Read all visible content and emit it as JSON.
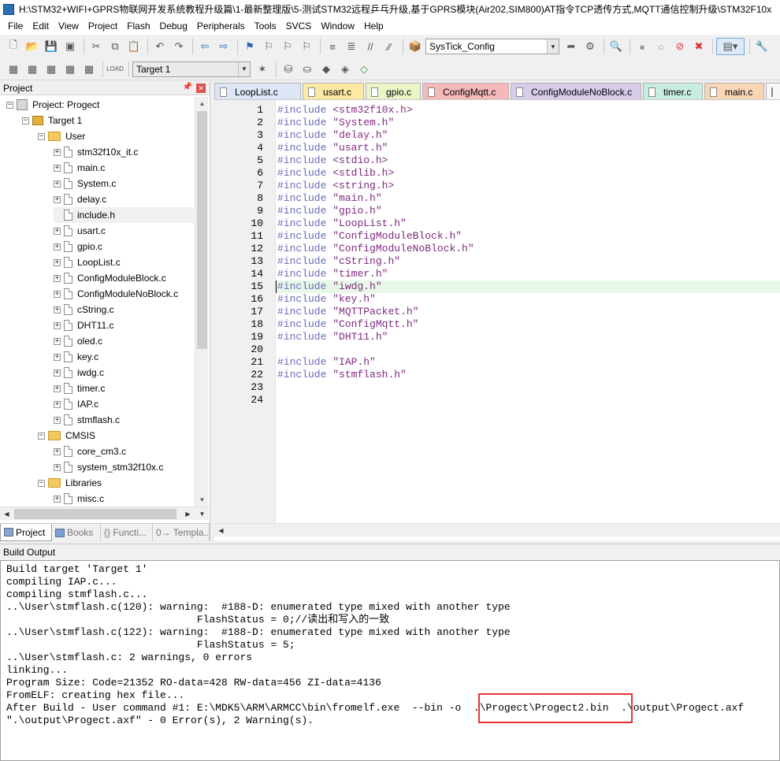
{
  "window": {
    "title": "H:\\STM32+WIFI+GPRS物联网开发系统教程升级篇\\1-最新整理版\\5-测试STM32远程乒乓升级,基于GPRS模块(Air202,SIM800)AT指令TCP透传方式,MQTT通信控制升级\\STM32F10x"
  },
  "menu": [
    "File",
    "Edit",
    "View",
    "Project",
    "Flash",
    "Debug",
    "Peripherals",
    "Tools",
    "SVCS",
    "Window",
    "Help"
  ],
  "toolbar": {
    "function_combo": "SysTick_Config",
    "target_combo": "Target 1"
  },
  "project_panel": {
    "title": "Project",
    "pin": "ᵖ",
    "tree": [
      {
        "label": "Project: Progect",
        "type": "project"
      },
      {
        "label": "Target 1",
        "type": "target"
      },
      {
        "label": "User",
        "type": "folder"
      },
      {
        "label": "stm32f10x_it.c",
        "type": "file"
      },
      {
        "label": "main.c",
        "type": "file"
      },
      {
        "label": "System.c",
        "type": "file"
      },
      {
        "label": "delay.c",
        "type": "file"
      },
      {
        "label": "include.h",
        "type": "file"
      },
      {
        "label": "usart.c",
        "type": "file"
      },
      {
        "label": "gpio.c",
        "type": "file"
      },
      {
        "label": "LoopList.c",
        "type": "file"
      },
      {
        "label": "ConfigModuleBlock.c",
        "type": "file"
      },
      {
        "label": "ConfigModuleNoBlock.c",
        "type": "file"
      },
      {
        "label": "cString.c",
        "type": "file"
      },
      {
        "label": "DHT11.c",
        "type": "file"
      },
      {
        "label": "oled.c",
        "type": "file"
      },
      {
        "label": "key.c",
        "type": "file"
      },
      {
        "label": "iwdg.c",
        "type": "file"
      },
      {
        "label": "timer.c",
        "type": "file"
      },
      {
        "label": "IAP.c",
        "type": "file"
      },
      {
        "label": "stmflash.c",
        "type": "file"
      },
      {
        "label": "CMSIS",
        "type": "folder"
      },
      {
        "label": "core_cm3.c",
        "type": "file"
      },
      {
        "label": "system_stm32f10x.c",
        "type": "file"
      },
      {
        "label": "Libraries",
        "type": "folder"
      },
      {
        "label": "misc.c",
        "type": "file"
      }
    ],
    "tabs": [
      "Project",
      "Books",
      "{} Functi...",
      "0→ Templa..."
    ]
  },
  "editor": {
    "tabs": [
      {
        "label": "LoopList.c",
        "color": "#dde6f5"
      },
      {
        "label": "usart.c",
        "color": "#fbe9a4"
      },
      {
        "label": "gpio.c",
        "color": "#e9f5c7"
      },
      {
        "label": "ConfigMqtt.c",
        "color": "#f5b9b9"
      },
      {
        "label": "ConfigModuleNoBlock.c",
        "color": "#d7cdea"
      },
      {
        "label": "timer.c",
        "color": "#c9ece2"
      },
      {
        "label": "main.c",
        "color": "#f9d6b5"
      }
    ],
    "highlight_line": 15,
    "lines": [
      {
        "n": "1",
        "kw": "#include",
        "arg": "<stm32f10x.h>"
      },
      {
        "n": "2",
        "kw": "#include",
        "arg": "\"System.h\""
      },
      {
        "n": "3",
        "kw": "#include",
        "arg": "\"delay.h\""
      },
      {
        "n": "4",
        "kw": "#include",
        "arg": "\"usart.h\""
      },
      {
        "n": "5",
        "kw": "#include",
        "arg": "<stdio.h>"
      },
      {
        "n": "6",
        "kw": "#include",
        "arg": "<stdlib.h>"
      },
      {
        "n": "7",
        "kw": "#include",
        "arg": "<string.h>"
      },
      {
        "n": "8",
        "kw": "#include",
        "arg": "\"main.h\""
      },
      {
        "n": "9",
        "kw": "#include",
        "arg": "\"gpio.h\""
      },
      {
        "n": "10",
        "kw": "#include",
        "arg": "\"LoopList.h\""
      },
      {
        "n": "11",
        "kw": "#include",
        "arg": "\"ConfigModuleBlock.h\""
      },
      {
        "n": "12",
        "kw": "#include",
        "arg": "\"ConfigModuleNoBlock.h\""
      },
      {
        "n": "13",
        "kw": "#include",
        "arg": "\"cString.h\""
      },
      {
        "n": "14",
        "kw": "#include",
        "arg": "\"timer.h\""
      },
      {
        "n": "15",
        "kw": "#include",
        "arg": "\"iwdg.h\""
      },
      {
        "n": "16",
        "kw": "#include",
        "arg": "\"key.h\""
      },
      {
        "n": "17",
        "kw": "#include",
        "arg": "\"MQTTPacket.h\""
      },
      {
        "n": "18",
        "kw": "#include",
        "arg": "\"ConfigMqtt.h\""
      },
      {
        "n": "19",
        "kw": "#include",
        "arg": "\"DHT11.h\""
      },
      {
        "n": "20",
        "kw": "",
        "arg": ""
      },
      {
        "n": "21",
        "kw": "#include",
        "arg": "\"IAP.h\""
      },
      {
        "n": "22",
        "kw": "#include",
        "arg": "\"stmflash.h\""
      },
      {
        "n": "23",
        "kw": "",
        "arg": ""
      },
      {
        "n": "24",
        "kw": "",
        "arg": ""
      }
    ]
  },
  "build_output": {
    "title": "Build Output",
    "lines": [
      "Build target 'Target 1'",
      "compiling IAP.c...",
      "compiling stmflash.c...",
      "..\\User\\stmflash.c(120): warning:  #188-D: enumerated type mixed with another type",
      "                               FlashStatus = 0;//读出和写入的一致",
      "..\\User\\stmflash.c(122): warning:  #188-D: enumerated type mixed with another type",
      "                               FlashStatus = 5;",
      "..\\User\\stmflash.c: 2 warnings, 0 errors",
      "linking...",
      "Program Size: Code=21352 RO-data=428 RW-data=456 ZI-data=4136",
      "FromELF: creating hex file...",
      "After Build - User command #1: E:\\MDK5\\ARM\\ARMCC\\bin\\fromelf.exe  --bin -o  .\\Progect\\Progect2.bin  .\\output\\Progect.axf",
      "\".\\output\\Progect.axf\" - 0 Error(s), 2 Warning(s)."
    ],
    "highlight_color": "#e53333"
  }
}
